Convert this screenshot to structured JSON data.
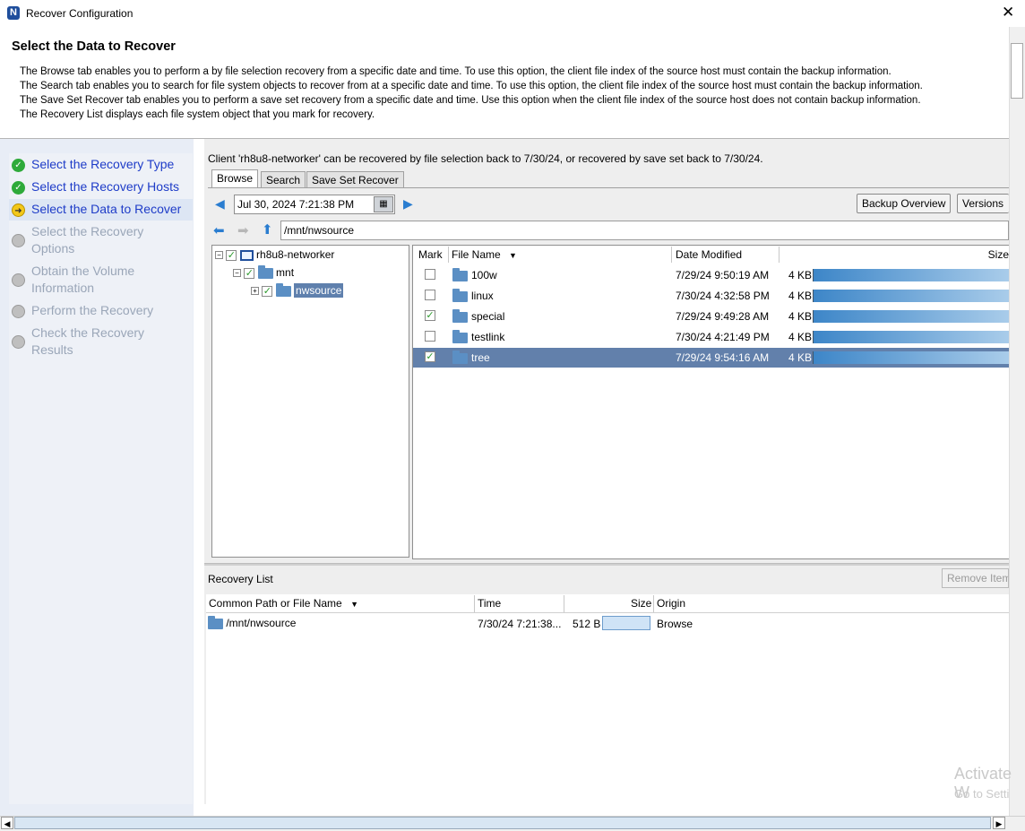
{
  "window": {
    "title": "Recover Configuration",
    "app_icon": "N"
  },
  "header": {
    "title": "Select the Data to Recover",
    "lines": [
      "The Browse tab enables you to perform a by file selection recovery from a specific date and time. To use this option, the client file index of the source host must contain the backup information.",
      "The Search tab enables you to search for file system objects to recover from at a specific date and time. To use this option, the client file index of the source host must contain the backup information.",
      "The Save Set Recover tab enables you to perform a save set recovery from a specific date and time.  Use this option when the client file index of the source host does not contain backup information.",
      "The Recovery List displays each file system object that you mark for recovery."
    ]
  },
  "steps": [
    {
      "label": "Select the Recovery Type",
      "status": "done"
    },
    {
      "label": "Select the Recovery Hosts",
      "status": "done"
    },
    {
      "label": "Select the Data to Recover",
      "status": "current"
    },
    {
      "label": "Select the Recovery Options",
      "status": "pending"
    },
    {
      "label": "Obtain the Volume Information",
      "status": "pending"
    },
    {
      "label": "Perform the Recovery",
      "status": "pending"
    },
    {
      "label": "Check the Recovery Results",
      "status": "pending"
    }
  ],
  "client_info": "Client 'rh8u8-networker' can be recovered by file selection back to 7/30/24, or recovered by save set back to 7/30/24.",
  "tabs": [
    "Browse",
    "Search",
    "Save Set Recover"
  ],
  "browse": {
    "date_value": "Jul 30, 2024 7:21:38 PM",
    "backup_overview_label": "Backup Overview",
    "versions_label": "Versions",
    "path_value": "/mnt/nwsource",
    "tree": {
      "root": "rh8u8-networker",
      "child": "mnt",
      "grandchild": "nwsource"
    },
    "columns": {
      "mark": "Mark",
      "file_name": "File Name",
      "date_modified": "Date Modified",
      "size": "Size"
    },
    "files": [
      {
        "name": "100w",
        "date": "7/29/24 9:50:19 AM",
        "size": "4 KB",
        "checked": false,
        "selected": false
      },
      {
        "name": "linux",
        "date": "7/30/24 4:32:58 PM",
        "size": "4 KB",
        "checked": false,
        "selected": false
      },
      {
        "name": "special",
        "date": "7/29/24 9:49:28 AM",
        "size": "4 KB",
        "checked": true,
        "selected": false
      },
      {
        "name": "testlink",
        "date": "7/30/24 4:21:49 PM",
        "size": "4 KB",
        "checked": false,
        "selected": false
      },
      {
        "name": "tree",
        "date": "7/29/24 9:54:16 AM",
        "size": "4 KB",
        "checked": true,
        "selected": true
      }
    ]
  },
  "recovery_list": {
    "label": "Recovery List",
    "remove_label": "Remove Item",
    "columns": {
      "path": "Common Path or File Name",
      "time": "Time",
      "size": "Size",
      "origin": "Origin"
    },
    "rows": [
      {
        "path": "/mnt/nwsource",
        "time": "7/30/24 7:21:38...",
        "size": "512 B",
        "origin": "Browse"
      }
    ]
  },
  "watermark": {
    "line1": "Activate W",
    "line2": "Go to Setti"
  }
}
